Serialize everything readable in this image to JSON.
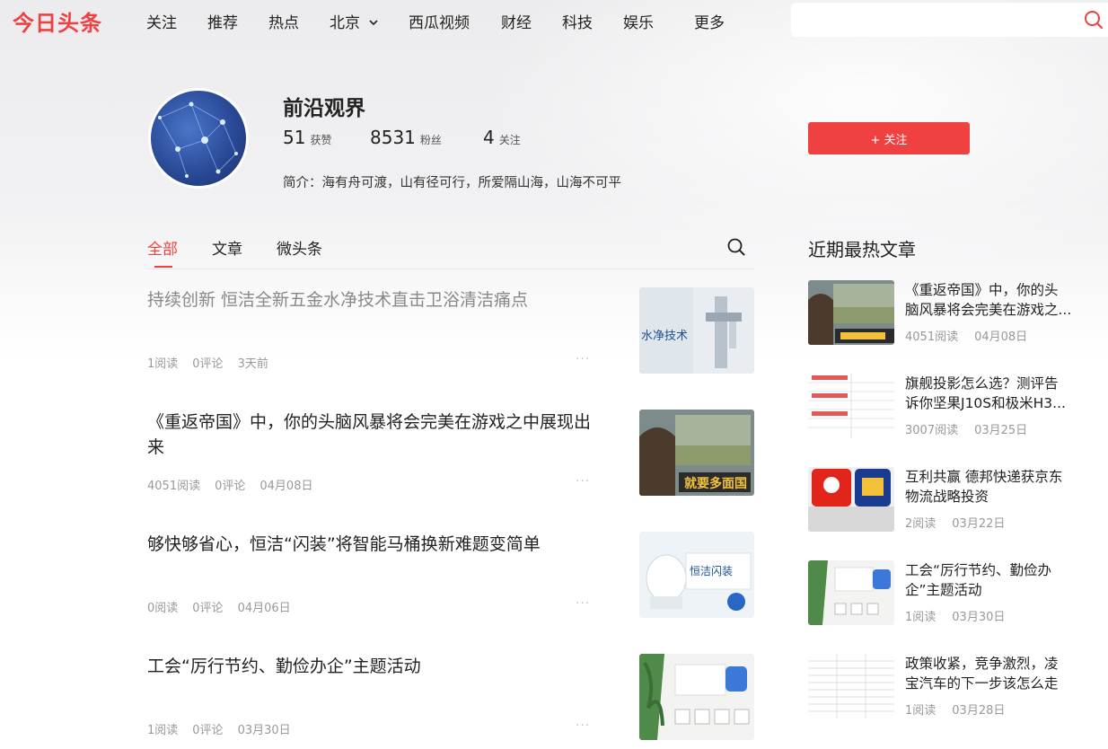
{
  "nav": {
    "logo": "今日头条",
    "items": [
      "关注",
      "推荐",
      "热点",
      "北京",
      "西瓜视频",
      "财经",
      "科技",
      "娱乐",
      "更多"
    ],
    "search_placeholder": ""
  },
  "profile": {
    "name": "前沿观界",
    "stats": [
      {
        "num": "51",
        "label": "获赞"
      },
      {
        "num": "8531",
        "label": "粉丝"
      },
      {
        "num": "4",
        "label": "关注"
      }
    ],
    "bio_label": "简介：",
    "bio_text": "海有舟可渡，山有径可行，所爱隔山海，山海不可平",
    "follow_button": "+ 关注"
  },
  "tabs": [
    "全部",
    "文章",
    "微头条"
  ],
  "feed": [
    {
      "title": "持续创新 恒洁全新五金水净技术直击卫浴清洁痛点",
      "reads": "1阅读",
      "comments": "0评论",
      "time": "3天前",
      "more": "···",
      "thumb_text": "水净技术"
    },
    {
      "title": "《重返帝国》中，你的头脑风暴将会完美在游戏之中展现出来",
      "reads": "4051阅读",
      "comments": "0评论",
      "time": "04月08日",
      "more": "···",
      "thumb_text": "就要多面国"
    },
    {
      "title": "够快够省心，恒洁“闪装”将智能马桶换新难题变简单",
      "reads": "0阅读",
      "comments": "0评论",
      "time": "04月06日",
      "more": "···",
      "thumb_text": "恒洁闪装"
    },
    {
      "title": "工会“厉行节约、勤俭办企”主题活动",
      "reads": "1阅读",
      "comments": "0评论",
      "time": "03月30日",
      "more": "···",
      "thumb_text": ""
    }
  ],
  "sidebar": {
    "title": "近期最热文章",
    "items": [
      {
        "line1": "《重返帝国》中，你的头",
        "line2": "脑风暴将会完美在游戏之...",
        "reads": "4051阅读",
        "time": "04月08日"
      },
      {
        "line1": "旗舰投影怎么选？测评告",
        "line2": "诉你坚果J10S和极米H3...",
        "reads": "3007阅读",
        "time": "03月25日"
      },
      {
        "line1": "互利共赢 德邦快递获京东",
        "line2": "物流战略投资",
        "reads": "2阅读",
        "time": "03月22日"
      },
      {
        "line1": "工会“厉行节约、勤俭办",
        "line2": "企”主题活动",
        "reads": "1阅读",
        "time": "03月30日"
      },
      {
        "line1": "政策收紧，竞争激烈，凌",
        "line2": "宝汽车的下一步该怎么走",
        "reads": "1阅读",
        "time": "03月28日"
      }
    ]
  },
  "colors": {
    "accent": "#f04142",
    "text": "#222222",
    "muted": "#999999"
  }
}
